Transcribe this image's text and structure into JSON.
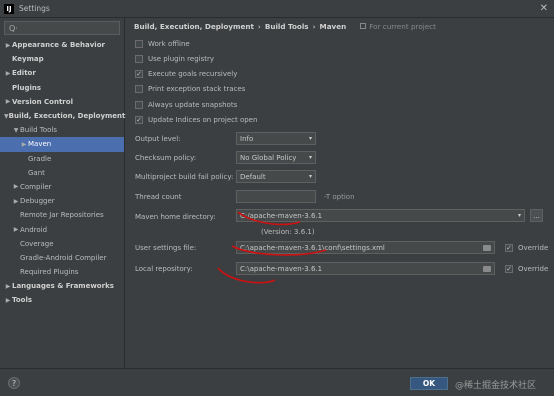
{
  "window": {
    "title": "Settings",
    "app_icon": "IJ",
    "close_glyph": "✕"
  },
  "sidebar": {
    "search_placeholder": "Q·",
    "items": [
      {
        "label": "Appearance & Behavior",
        "arrow": "▶",
        "bold": true
      },
      {
        "label": "Keymap",
        "arrow": "",
        "bold": true
      },
      {
        "label": "Editor",
        "arrow": "▶",
        "bold": true
      },
      {
        "label": "Plugins",
        "arrow": "",
        "bold": true
      },
      {
        "label": "Version Control",
        "arrow": "▶",
        "bold": true
      },
      {
        "label": "Build, Execution, Deployment",
        "arrow": "▼",
        "bold": true
      },
      {
        "label": "Build Tools",
        "arrow": "▼",
        "bold": false
      },
      {
        "label": "Maven",
        "arrow": "▶",
        "bold": false,
        "selected": true
      },
      {
        "label": "Gradle",
        "arrow": "",
        "bold": false
      },
      {
        "label": "Gant",
        "arrow": "",
        "bold": false
      },
      {
        "label": "Compiler",
        "arrow": "▶",
        "bold": false
      },
      {
        "label": "Debugger",
        "arrow": "▶",
        "bold": false
      },
      {
        "label": "Remote Jar Repositories",
        "arrow": "",
        "bold": false
      },
      {
        "label": "Android",
        "arrow": "▶",
        "bold": false
      },
      {
        "label": "Coverage",
        "arrow": "",
        "bold": false
      },
      {
        "label": "Gradle-Android Compiler",
        "arrow": "",
        "bold": false
      },
      {
        "label": "Required Plugins",
        "arrow": "",
        "bold": false
      },
      {
        "label": "Languages & Frameworks",
        "arrow": "▶",
        "bold": true
      },
      {
        "label": "Tools",
        "arrow": "▶",
        "bold": true
      }
    ]
  },
  "breadcrumb": {
    "parts": [
      "Build, Execution, Deployment",
      "Build Tools",
      "Maven"
    ],
    "separator": "›",
    "scope": "For current project"
  },
  "checkboxes": [
    {
      "label": "Work offline",
      "checked": false
    },
    {
      "label": "Use plugin registry",
      "checked": false
    },
    {
      "label": "Execute goals recursively",
      "checked": true
    },
    {
      "label": "Print exception stack traces",
      "checked": false
    },
    {
      "label": "Always update snapshots",
      "checked": false
    },
    {
      "label": "Update Indices on project open",
      "checked": true
    }
  ],
  "fields": {
    "output_level": {
      "label": "Output level:",
      "value": "Info"
    },
    "checksum_policy": {
      "label": "Checksum policy:",
      "value": "No Global Policy"
    },
    "multiproject_policy": {
      "label": "Multiproject build fail policy:",
      "value": "Default"
    },
    "thread_count": {
      "label": "Thread count",
      "value": "",
      "hint": "-T option"
    },
    "maven_home": {
      "label": "Maven home directory:",
      "value": "C:/apache-maven-3.6.1",
      "button": "...",
      "version": "(Version: 3.6.1)"
    },
    "user_settings": {
      "label": "User settings file:",
      "value": "C:\\apache-maven-3.6.1\\conf\\settings.xml",
      "override_label": "Override",
      "override_checked": true
    },
    "local_repo": {
      "label": "Local repository:",
      "value": "C:\\apache-maven-3.6.1",
      "override_label": "Override",
      "override_checked": true
    }
  },
  "footer": {
    "help": "?",
    "ok": "OK",
    "watermark": "@稀土掘金技术社区"
  },
  "colors": {
    "selection": "#4b6eaf",
    "annotation": "#d01010",
    "ok_button": "#365880"
  },
  "icons": {
    "dropdown": "▾",
    "checkmark": "✓"
  }
}
